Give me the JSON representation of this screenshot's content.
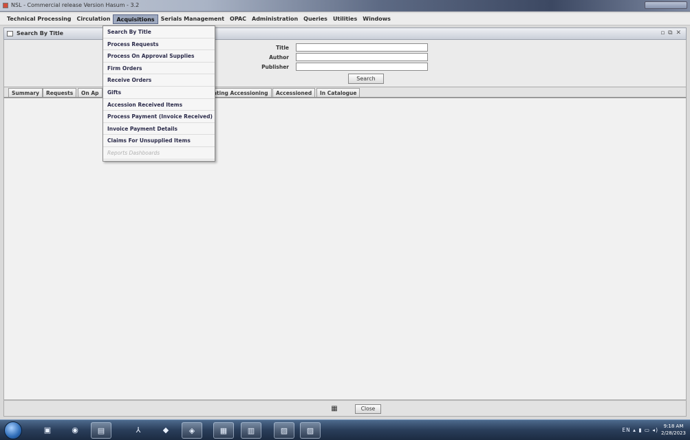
{
  "window": {
    "title": "NSL - Commercial release Version Hasum - 3.2"
  },
  "menubar": {
    "items": [
      {
        "label": "Technical Processing"
      },
      {
        "label": "Circulation"
      },
      {
        "label": "Acquisitions"
      },
      {
        "label": "Serials Management"
      },
      {
        "label": "OPAC"
      },
      {
        "label": "Administration"
      },
      {
        "label": "Queries"
      },
      {
        "label": "Utilities"
      },
      {
        "label": "Windows"
      }
    ]
  },
  "frame": {
    "title": "Search By Title"
  },
  "form": {
    "title_label": "Title",
    "author_label": "Author",
    "publisher_label": "Publisher",
    "title_value": "",
    "author_value": "",
    "publisher_value": "",
    "search_label": "Search"
  },
  "tabs": [
    {
      "label": "Summary"
    },
    {
      "label": "Requests"
    },
    {
      "label": "On Ap"
    },
    {
      "label": "ating Accessioning"
    },
    {
      "label": "Accessioned"
    },
    {
      "label": "In Catalogue"
    }
  ],
  "dropdown": {
    "items": [
      {
        "label": "Search By Title"
      },
      {
        "label": "Process Requests"
      },
      {
        "label": "Process On Approval Supplies"
      },
      {
        "label": "Firm Orders"
      },
      {
        "label": "Receive Orders"
      },
      {
        "label": "Gifts"
      },
      {
        "label": "Accession Received Items"
      },
      {
        "label": "Process Payment (Invoice Received)"
      },
      {
        "label": "Invoice Payment Details"
      },
      {
        "label": "Claims For Unsupplied Items"
      },
      {
        "label": "Reports Dashboards"
      }
    ]
  },
  "bottom": {
    "close_label": "Close"
  },
  "taskbar": {
    "tray_text": "EN",
    "time": "9:18 AM",
    "date": "2/28/2023"
  }
}
